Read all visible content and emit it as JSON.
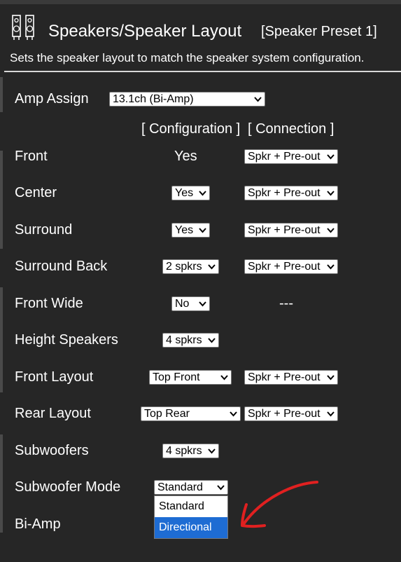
{
  "header": {
    "title": "Speakers/Speaker Layout",
    "preset": "[Speaker Preset 1]",
    "description": "Sets the speaker layout to match the speaker system configuration."
  },
  "amp_assign": {
    "label": "Amp Assign",
    "value": "13.1ch (Bi-Amp)"
  },
  "columns": {
    "configuration": "[ Configuration ]",
    "connection": "[ Connection ]"
  },
  "rows": [
    {
      "label": "Front",
      "config_static": "Yes",
      "connection": "Spkr + Pre-out"
    },
    {
      "label": "Center",
      "config": "Yes",
      "connection": "Spkr + Pre-out"
    },
    {
      "label": "Surround",
      "config": "Yes",
      "connection": "Spkr + Pre-out"
    },
    {
      "label": "Surround Back",
      "config": "2 spkrs",
      "connection": "Spkr + Pre-out"
    },
    {
      "label": "Front Wide",
      "config": "No",
      "connection_static": "---"
    },
    {
      "label": "Height Speakers",
      "config": "4 spkrs"
    },
    {
      "label": "Front Layout",
      "config": "Top Front",
      "connection": "Spkr + Pre-out"
    },
    {
      "label": "Rear Layout",
      "config": "Top Rear",
      "connection": "Spkr + Pre-out"
    },
    {
      "label": "Subwoofers",
      "config": "4 spkrs"
    },
    {
      "label": "Subwoofer Mode",
      "config": "Standard"
    },
    {
      "label": "Bi-Amp"
    }
  ],
  "subwoofer_mode_dropdown": {
    "options": [
      "Standard",
      "Directional"
    ],
    "highlighted": "Directional"
  },
  "colors": {
    "background": "#262626",
    "highlight": "#1e6cd3",
    "annotation": "#e02020"
  },
  "icons": {
    "header": "speakers-icon",
    "select": "chevron-down-icon",
    "annotation": "red-arrow-icon"
  }
}
